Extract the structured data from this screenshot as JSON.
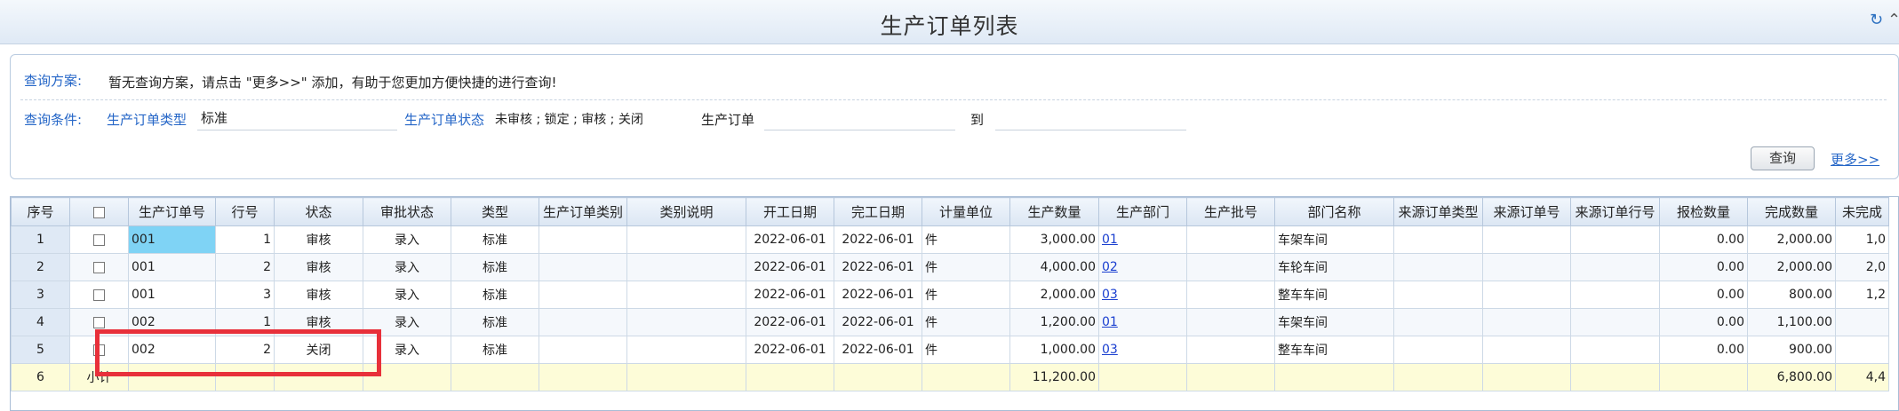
{
  "window": {
    "title": "生产订单列表"
  },
  "query": {
    "scheme_label": "查询方案:",
    "scheme_hint": "暂无查询方案，请点击 \"更多>>\" 添加，有助于您更加方便快捷的进行查询!",
    "condition_label": "查询条件:",
    "order_type_label": "生产订单类型",
    "order_type_value": "标准",
    "order_status_label": "生产订单状态",
    "order_status_value": "未审核 ; 锁定 ; 审核 ; 关闭",
    "order_no_label": "生产订单",
    "order_no_from": "",
    "to_label": "到",
    "order_no_to": "",
    "query_button": "查询",
    "more_link": "更多>>"
  },
  "table": {
    "headers": [
      "序号",
      "",
      "生产订单号",
      "行号",
      "状态",
      "审批状态",
      "类型",
      "生产订单类别",
      "类别说明",
      "开工日期",
      "完工日期",
      "计量单位",
      "生产数量",
      "生产部门",
      "生产批号",
      "部门名称",
      "来源订单类型",
      "来源订单号",
      "来源订单行号",
      "报检数量",
      "完成数量",
      "未完成"
    ],
    "rows": [
      [
        "1",
        "",
        "001",
        "1",
        "审核",
        "录入",
        "标准",
        "",
        "",
        "2022-06-01",
        "2022-06-01",
        "件",
        "3,000.00",
        "01",
        "",
        "车架车间",
        "",
        "",
        "",
        "0.00",
        "2,000.00",
        "1,0"
      ],
      [
        "2",
        "",
        "001",
        "2",
        "审核",
        "录入",
        "标准",
        "",
        "",
        "2022-06-01",
        "2022-06-01",
        "件",
        "4,000.00",
        "02",
        "",
        "车轮车间",
        "",
        "",
        "",
        "0.00",
        "2,000.00",
        "2,0"
      ],
      [
        "3",
        "",
        "001",
        "3",
        "审核",
        "录入",
        "标准",
        "",
        "",
        "2022-06-01",
        "2022-06-01",
        "件",
        "2,000.00",
        "03",
        "",
        "整车车间",
        "",
        "",
        "",
        "0.00",
        "800.00",
        "1,2"
      ],
      [
        "4",
        "",
        "002",
        "1",
        "审核",
        "录入",
        "标准",
        "",
        "",
        "2022-06-01",
        "2022-06-01",
        "件",
        "1,200.00",
        "01",
        "",
        "车架车间",
        "",
        "",
        "",
        "0.00",
        "1,100.00",
        ""
      ],
      [
        "5",
        "",
        "002",
        "2",
        "关闭",
        "录入",
        "标准",
        "",
        "",
        "2022-06-01",
        "2022-06-01",
        "件",
        "1,000.00",
        "03",
        "",
        "整车车间",
        "",
        "",
        "",
        "0.00",
        "900.00",
        ""
      ]
    ],
    "subtotal": [
      "6",
      "小计",
      "",
      "",
      "",
      "",
      "",
      "",
      "",
      "",
      "",
      "",
      "11,200.00",
      "",
      "",
      "",
      "",
      "",
      "",
      "",
      "6,800.00",
      "4,4"
    ]
  },
  "colors": {
    "accent": "#2566c7",
    "annotation": "#e8303a",
    "selected_cell": "#7fd3f5",
    "subtotal_bg": "#fdfcd8"
  },
  "icons": {
    "refresh": "refresh-icon",
    "collapse": "collapse-icon"
  }
}
